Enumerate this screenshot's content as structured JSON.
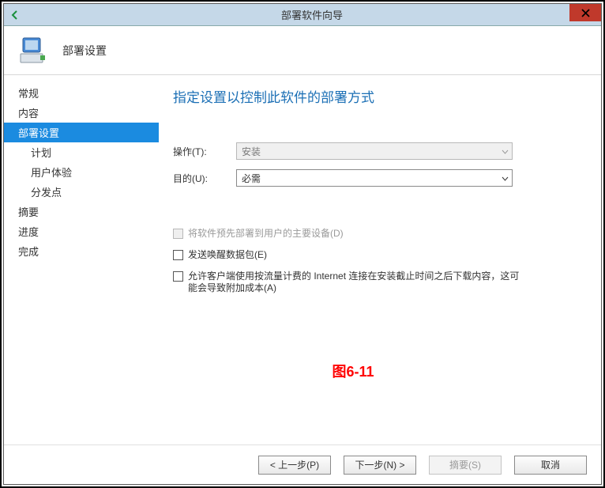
{
  "window": {
    "title": "部署软件向导"
  },
  "header": {
    "title": "部署设置"
  },
  "sidebar": {
    "items": [
      {
        "label": "常规",
        "sub": false,
        "selected": false
      },
      {
        "label": "内容",
        "sub": false,
        "selected": false
      },
      {
        "label": "部署设置",
        "sub": false,
        "selected": true
      },
      {
        "label": "计划",
        "sub": true,
        "selected": false
      },
      {
        "label": "用户体验",
        "sub": true,
        "selected": false
      },
      {
        "label": "分发点",
        "sub": true,
        "selected": false
      },
      {
        "label": "摘要",
        "sub": false,
        "selected": false
      },
      {
        "label": "进度",
        "sub": false,
        "selected": false
      },
      {
        "label": "完成",
        "sub": false,
        "selected": false
      }
    ]
  },
  "content": {
    "heading": "指定设置以控制此软件的部署方式",
    "action_label": "操作(T):",
    "action_value": "安装",
    "purpose_label": "目的(U):",
    "purpose_value": "必需",
    "checks": [
      {
        "label": "将软件预先部署到用户的主要设备(D)",
        "disabled": true
      },
      {
        "label": "发送唤醒数据包(E)",
        "disabled": false
      },
      {
        "label": "允许客户端使用按流量计费的 Internet 连接在安装截止时间之后下载内容，这可能会导致附加成本(A)",
        "disabled": false
      }
    ],
    "figure_label": "图6-11"
  },
  "footer": {
    "prev": "< 上一步(P)",
    "next": "下一步(N) >",
    "summary": "摘要(S)",
    "cancel": "取消"
  }
}
